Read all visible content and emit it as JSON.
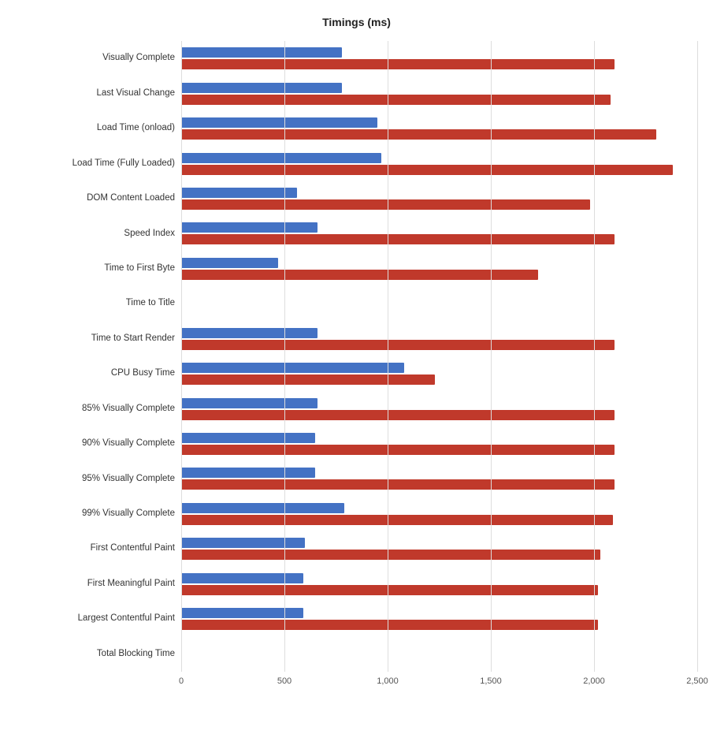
{
  "title": "Timings (ms)",
  "colors": {
    "blue": "#4472C4",
    "red": "#C0392B",
    "grid": "#dddddd"
  },
  "xAxis": {
    "max": 2500,
    "ticks": [
      0,
      500,
      1000,
      1500,
      2000,
      2500
    ],
    "labels": [
      "0",
      "500",
      "1,000",
      "1,500",
      "2,000",
      "2,500"
    ]
  },
  "rows": [
    {
      "label": "Visually Complete",
      "blue": 780,
      "red": 2100
    },
    {
      "label": "Last Visual Change",
      "blue": 780,
      "red": 2080
    },
    {
      "label": "Load Time (onload)",
      "blue": 950,
      "red": 2300
    },
    {
      "label": "Load Time (Fully Loaded)",
      "blue": 970,
      "red": 2380
    },
    {
      "label": "DOM Content Loaded",
      "blue": 560,
      "red": 1980
    },
    {
      "label": "Speed Index",
      "blue": 660,
      "red": 2100
    },
    {
      "label": "Time to First Byte",
      "blue": 470,
      "red": 1730
    },
    {
      "label": "Time to Title",
      "blue": 0,
      "red": 0
    },
    {
      "label": "Time to Start Render",
      "blue": 660,
      "red": 2100
    },
    {
      "label": "CPU Busy Time",
      "blue": 1080,
      "red": 1230
    },
    {
      "label": "85% Visually Complete",
      "blue": 660,
      "red": 2100
    },
    {
      "label": "90% Visually Complete",
      "blue": 650,
      "red": 2100
    },
    {
      "label": "95% Visually Complete",
      "blue": 650,
      "red": 2100
    },
    {
      "label": "99% Visually Complete",
      "blue": 790,
      "red": 2090
    },
    {
      "label": "First Contentful Paint",
      "blue": 600,
      "red": 2030
    },
    {
      "label": "First Meaningful Paint",
      "blue": 590,
      "red": 2020
    },
    {
      "label": "Largest Contentful Paint",
      "blue": 590,
      "red": 2020
    },
    {
      "label": "Total Blocking Time",
      "blue": 0,
      "red": 0
    }
  ]
}
